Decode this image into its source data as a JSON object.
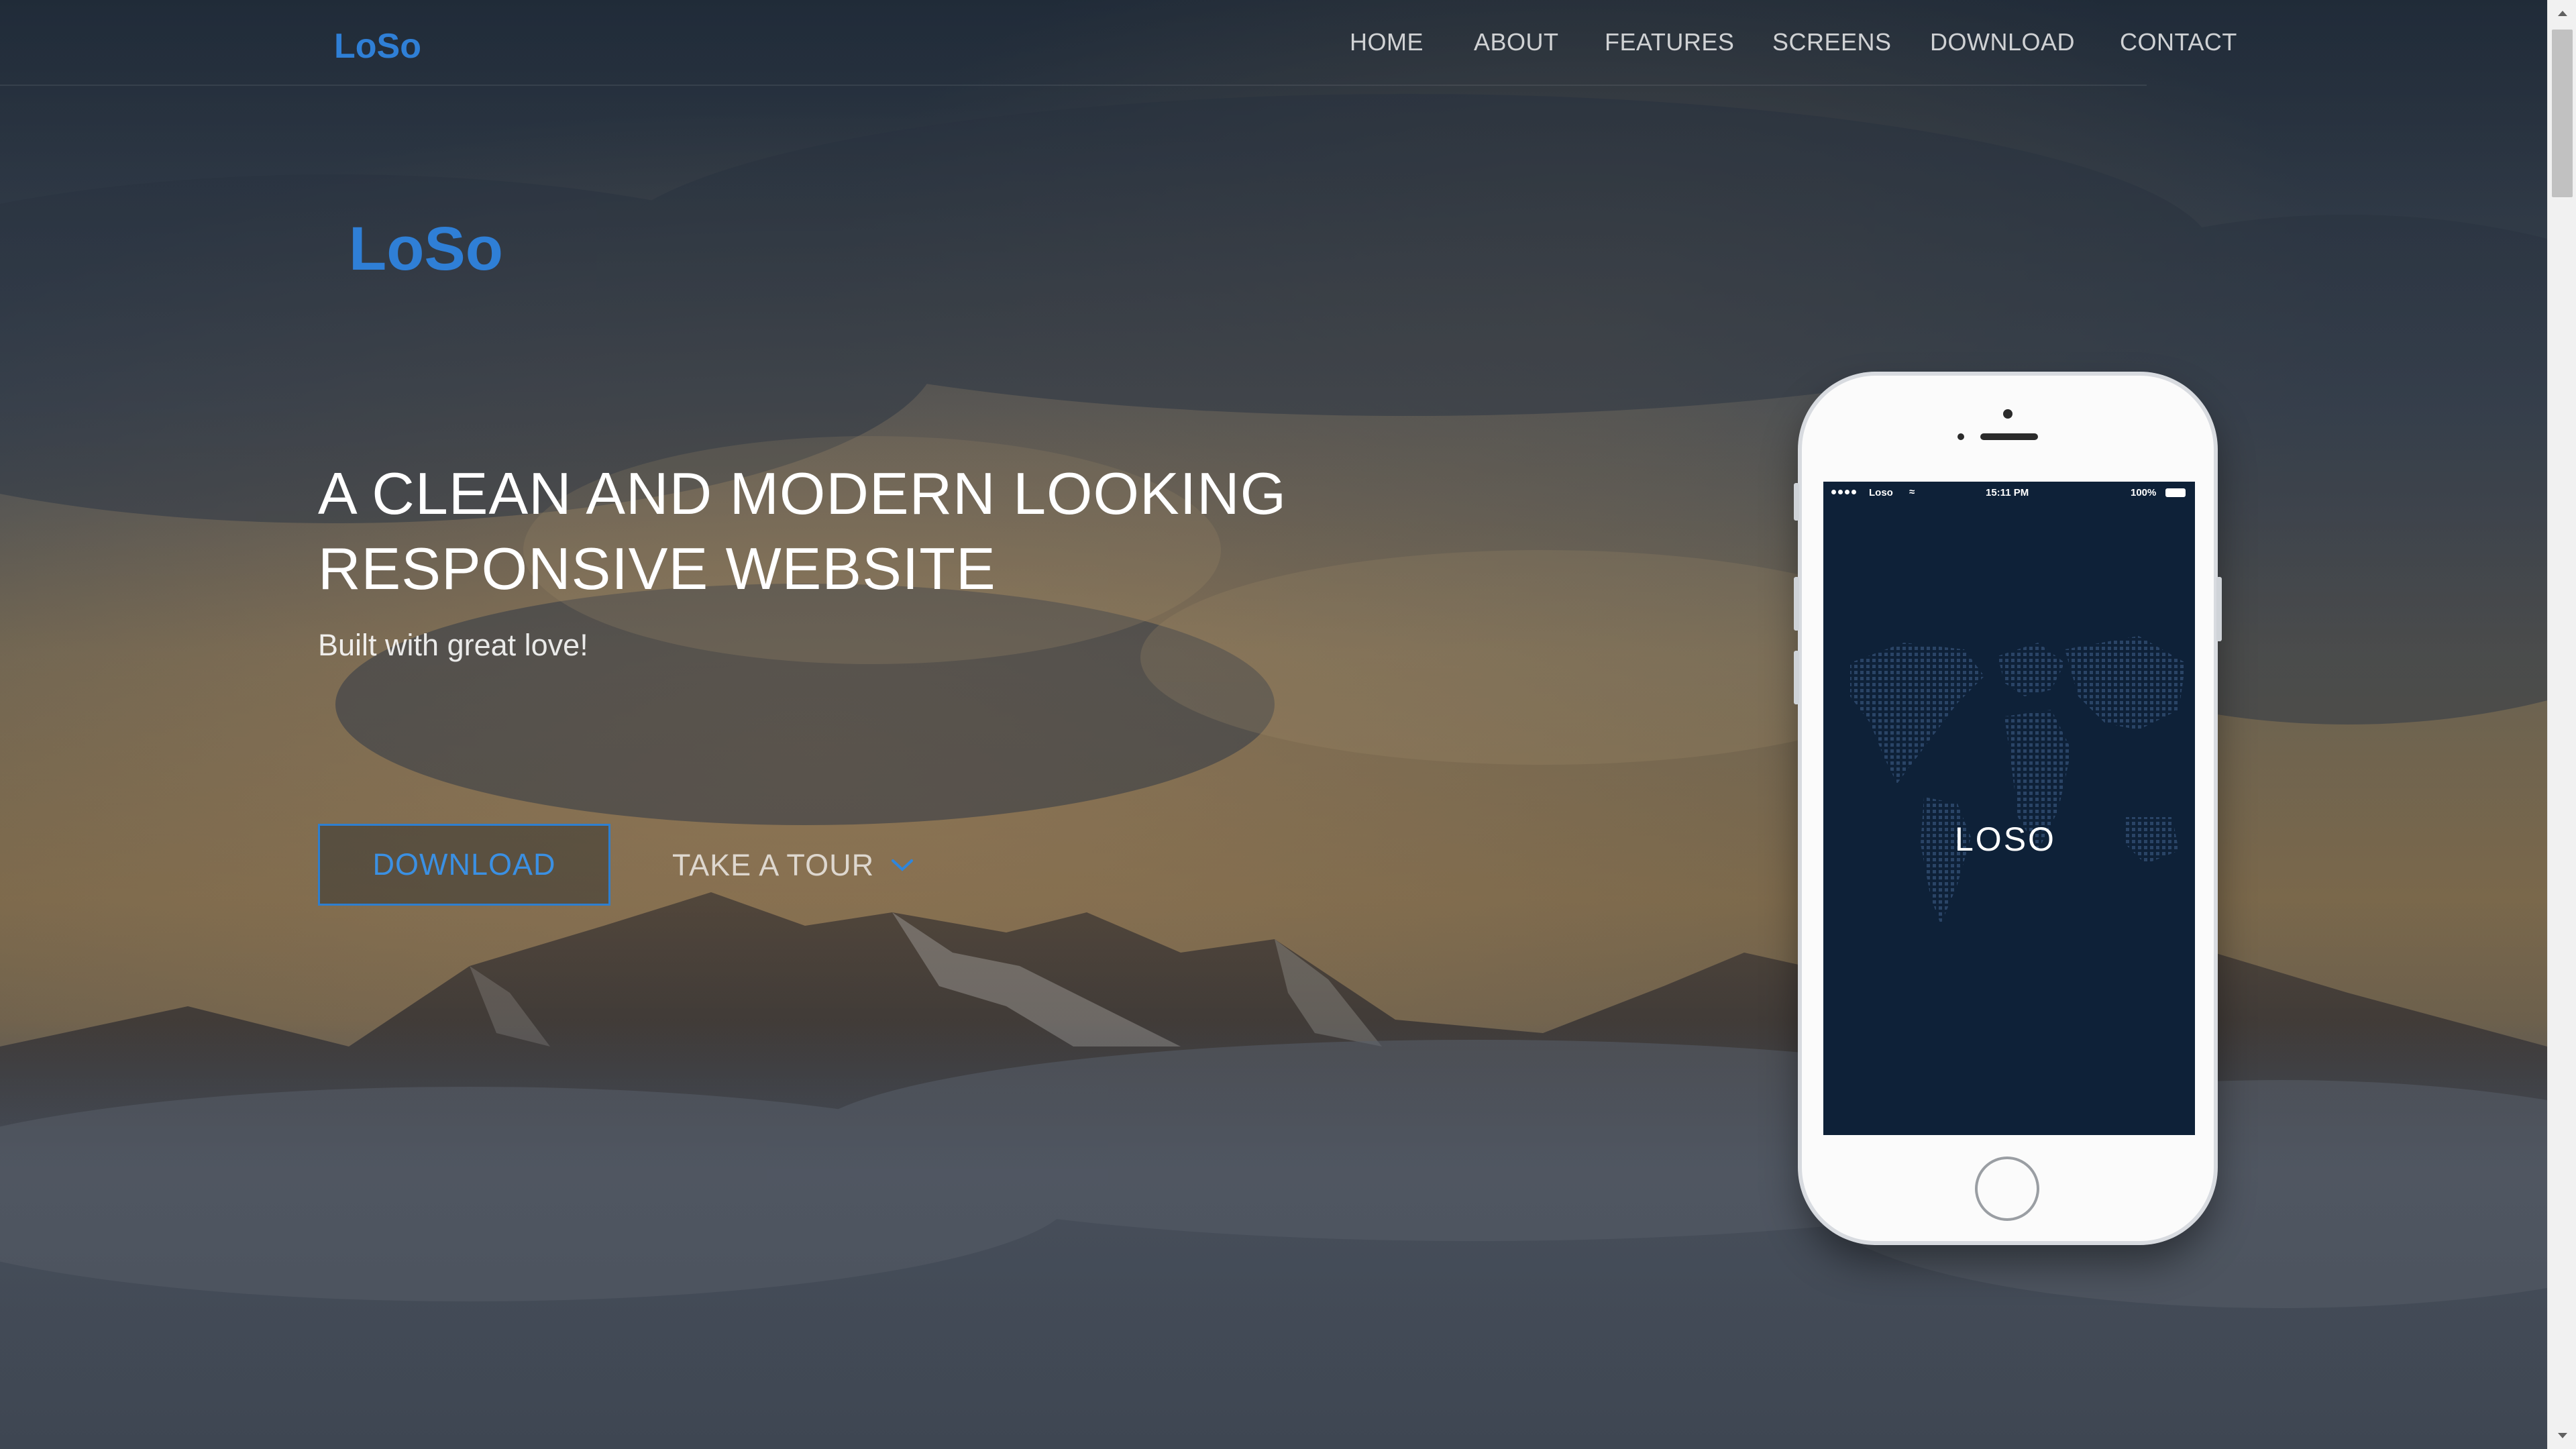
{
  "brand": {
    "logo_text": "LoSo",
    "logo_color": "#2f7fd6",
    "phone_logo_text": "LOSO"
  },
  "nav": {
    "items": [
      {
        "label": "HOME"
      },
      {
        "label": "ABOUT"
      },
      {
        "label": "FEATURES"
      },
      {
        "label": "SCREENS"
      },
      {
        "label": "DOWNLOAD"
      },
      {
        "label": "CONTACT"
      }
    ]
  },
  "hero": {
    "title_line1": "A CLEAN AND MODERN LOOKING",
    "title_line2": "RESPONSIVE WEBSITE",
    "subtitle": "Built with great love!",
    "download_label": "DOWNLOAD",
    "tour_label": "TAKE A TOUR",
    "accent_color": "#2e7fd0"
  },
  "phone": {
    "carrier": "Loso",
    "time": "15:11 PM",
    "battery": "100%",
    "screen_color": "#0e2138"
  },
  "icons": {
    "tour": "chevron-down-icon",
    "status": [
      "signal-dots-icon",
      "wifi-icon",
      "battery-icon"
    ],
    "scroll": [
      "arrow-up-icon",
      "arrow-down-icon"
    ]
  }
}
